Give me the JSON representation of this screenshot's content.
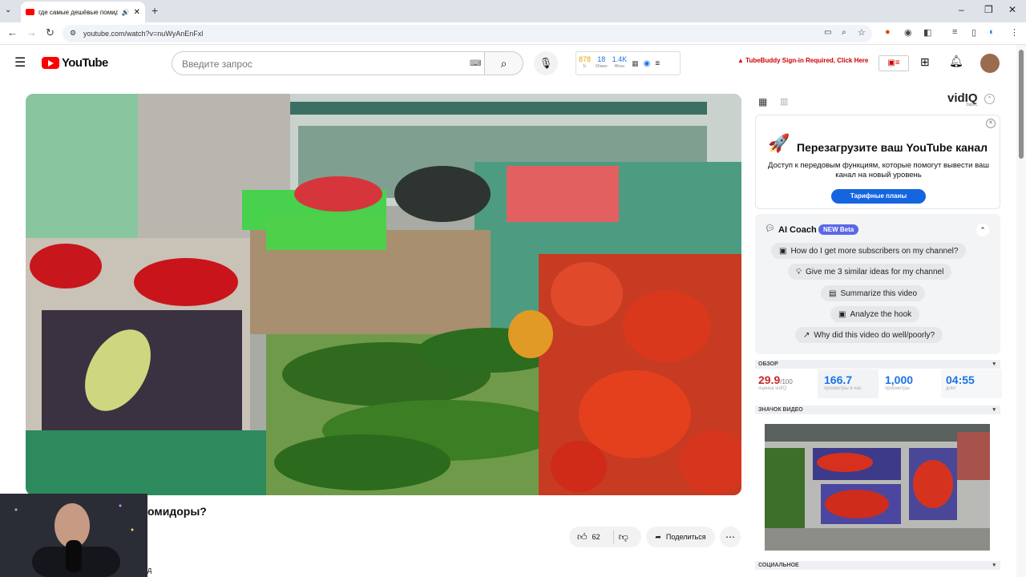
{
  "browser": {
    "tab_title": "где самые дешёвые помидоры",
    "url": "youtube.com/watch?v=nuWyAnEnFxl"
  },
  "youtube": {
    "logo_text": "YouTube",
    "search_placeholder": "Введите запрос",
    "tubebuddy_notice": "TubeBuddy Sign-in Required, Click Here",
    "header_stats": [
      {
        "value": "878",
        "label": "1г",
        "color": "#e8a200"
      },
      {
        "value": "18",
        "label": "60мин",
        "color": "#1a73e8"
      },
      {
        "value": "1.4K",
        "label": "48час",
        "color": "#1a73e8"
      }
    ],
    "video_title_fragment": "омидоры?",
    "likes": "62",
    "share_label": "Поделиться",
    "below_fragment": "д"
  },
  "vidiq": {
    "brand": "vidIQ",
    "tier": "basic",
    "promo_title": "Перезагрузите ваш YouTube канал",
    "promo_text": "Доступ к передовым функциям, которые помогут вывести ваш канал на новый уровень",
    "promo_button": "Тарифные планы",
    "coach_title": "AI Coach",
    "coach_badge": "NEW Beta",
    "coach_prompts": [
      "How do I get more subscribers on my channel?",
      "Give me 3 similar ideas for my channel",
      "Summarize this video",
      "Analyze the hook",
      "Why did this video do well/poorly?"
    ],
    "overview_label": "ОБЗОР",
    "score_value": "29.9",
    "score_max": "/100",
    "score_label": "оценка vidIQ",
    "metrics": [
      {
        "value": "166.7",
        "label": "просмотры в час"
      },
      {
        "value": "1,000",
        "label": "просмотры"
      },
      {
        "value": "04:55",
        "label": "длит"
      }
    ],
    "thumbnail_label": "ЗНАЧОК ВИДЕО",
    "social_label": "СОЦИАЛЬНОЕ"
  }
}
